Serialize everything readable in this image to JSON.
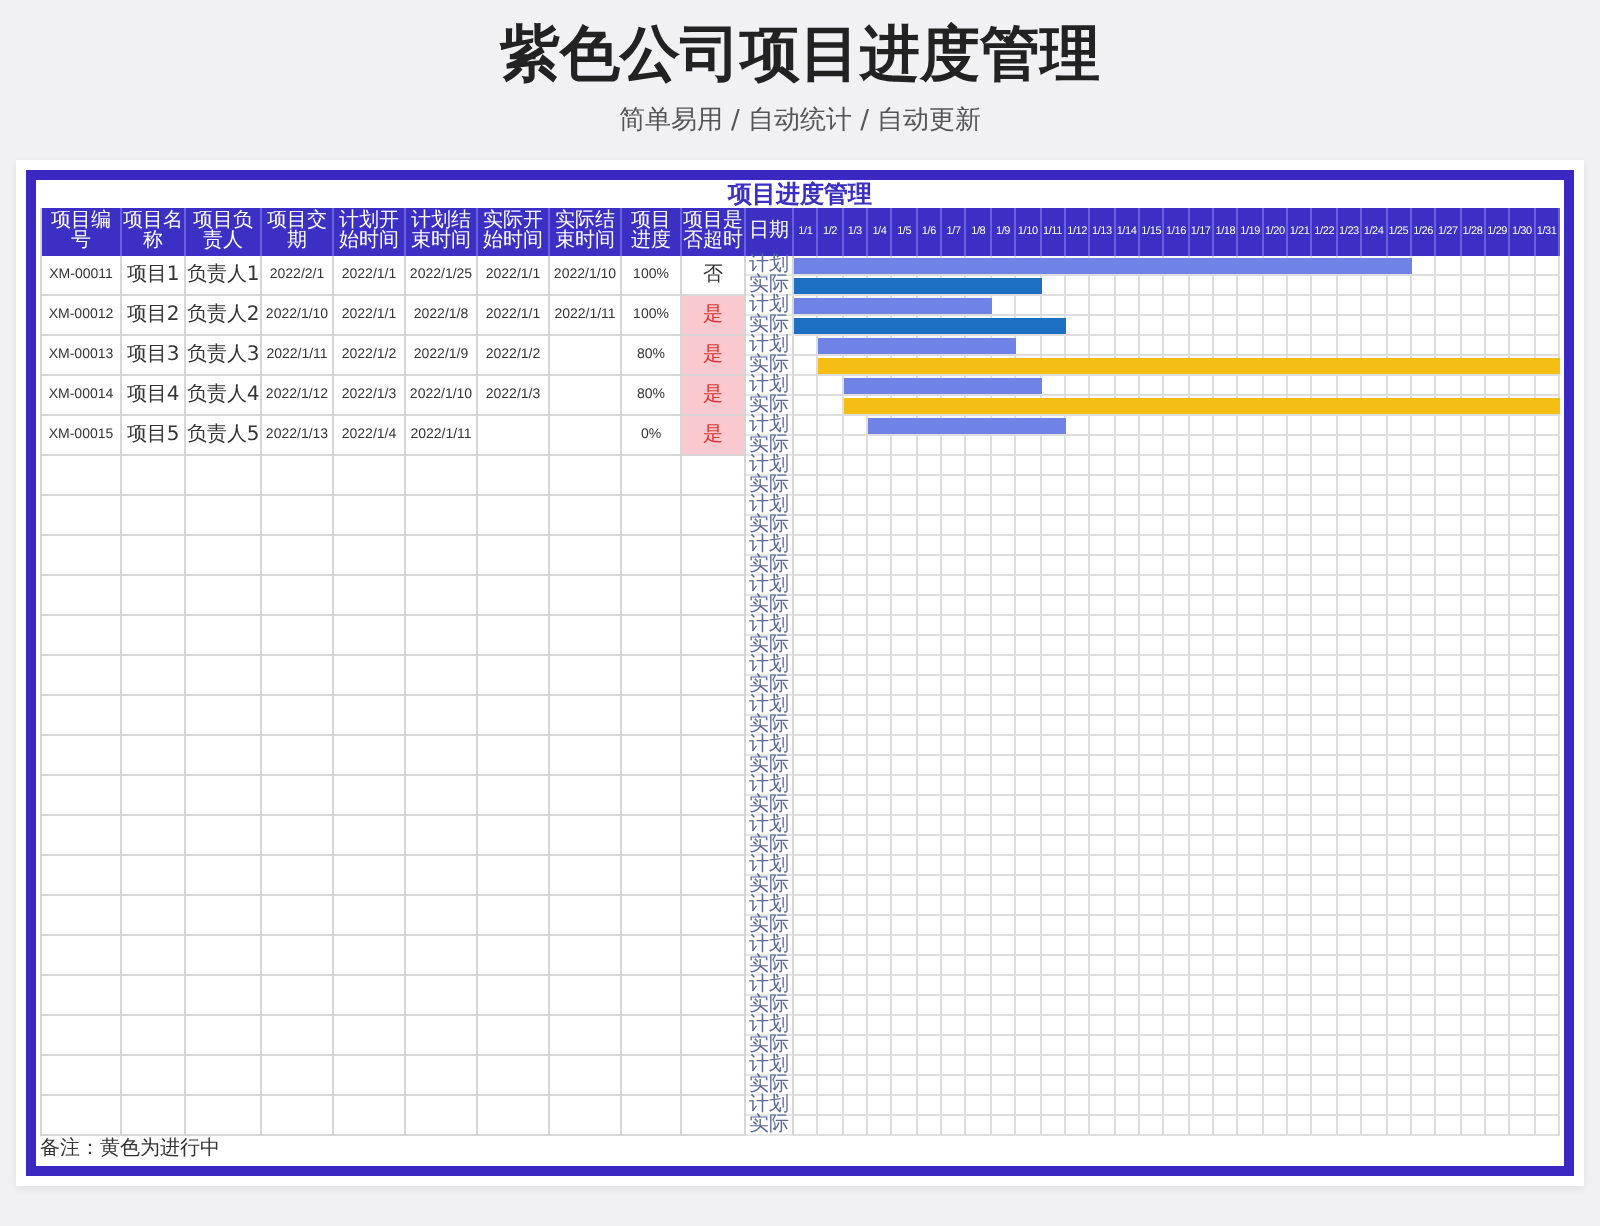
{
  "page_title": "紫色公司项目进度管理",
  "subtitle": "简单易用 / 自动统计 / 自动更新",
  "sheet": {
    "title": "项目进度管理",
    "columns": [
      "项目编号",
      "项目名称",
      "项目负责人",
      "项目交期",
      "计划开始时间",
      "计划结束时间",
      "实际开始时间",
      "实际结束时间",
      "项目进度",
      "项目是否超时",
      "日期"
    ],
    "days": [
      "1/1",
      "1/2",
      "1/3",
      "1/4",
      "1/5",
      "1/6",
      "1/7",
      "1/8",
      "1/9",
      "1/10",
      "1/11",
      "1/12",
      "1/13",
      "1/14",
      "1/15",
      "1/16",
      "1/17",
      "1/18",
      "1/19",
      "1/20",
      "1/21",
      "1/22",
      "1/23",
      "1/24",
      "1/25",
      "1/26",
      "1/27",
      "1/28",
      "1/29",
      "1/30",
      "1/31"
    ],
    "rows": [
      {
        "id": "XM-00011",
        "name": "项目1",
        "owner": "负责人1",
        "due": "2022/2/1",
        "plan_start": "2022/1/1",
        "plan_end": "2022/1/25",
        "actual_start": "2022/1/1",
        "actual_end": "2022/1/10",
        "progress": "100%",
        "overdue_text": "否",
        "overdue": false,
        "plan_label": "计划",
        "actual_label": "实际"
      },
      {
        "id": "XM-00012",
        "name": "项目2",
        "owner": "负责人2",
        "due": "2022/1/10",
        "plan_start": "2022/1/1",
        "plan_end": "2022/1/8",
        "actual_start": "2022/1/1",
        "actual_end": "2022/1/11",
        "progress": "100%",
        "overdue_text": "是",
        "overdue": true,
        "plan_label": "计划",
        "actual_label": "实际"
      },
      {
        "id": "XM-00013",
        "name": "项目3",
        "owner": "负责人3",
        "due": "2022/1/11",
        "plan_start": "2022/1/2",
        "plan_end": "2022/1/9",
        "actual_start": "2022/1/2",
        "progress": "80%",
        "overdue_text": "是",
        "overdue": true,
        "plan_label": "计划",
        "actual_label": "实际"
      },
      {
        "id": "XM-00014",
        "name": "项目4",
        "owner": "负责人4",
        "due": "2022/1/12",
        "plan_start": "2022/1/3",
        "plan_end": "2022/1/10",
        "actual_start": "2022/1/3",
        "progress": "80%",
        "overdue_text": "是",
        "overdue": true,
        "plan_label": "计划",
        "actual_label": "实际"
      },
      {
        "id": "XM-00015",
        "name": "项目5",
        "owner": "负责人5",
        "due": "2022/1/13",
        "plan_start": "2022/1/4",
        "plan_end": "2022/1/11",
        "progress": "0%",
        "overdue_text": "是",
        "overdue": true,
        "plan_label": "计划",
        "actual_label": "实际"
      },
      {
        "plan_label": "计划",
        "actual_label": "实际"
      },
      {
        "plan_label": "计划",
        "actual_label": "实际"
      },
      {
        "plan_label": "计划",
        "actual_label": "实际"
      },
      {
        "plan_label": "计划",
        "actual_label": "实际"
      },
      {
        "plan_label": "计划",
        "actual_label": "实际"
      },
      {
        "plan_label": "计划",
        "actual_label": "实际"
      },
      {
        "plan_label": "计划",
        "actual_label": "实际"
      },
      {
        "plan_label": "计划",
        "actual_label": "实际"
      },
      {
        "plan_label": "计划",
        "actual_label": "实际"
      },
      {
        "plan_label": "计划",
        "actual_label": "实际"
      },
      {
        "plan_label": "计划",
        "actual_label": "实际"
      },
      {
        "plan_label": "计划",
        "actual_label": "实际"
      },
      {
        "plan_label": "计划",
        "actual_label": "实际"
      },
      {
        "plan_label": "计划",
        "actual_label": "实际"
      },
      {
        "plan_label": "计划",
        "actual_label": "实际"
      },
      {
        "plan_label": "计划",
        "actual_label": "实际"
      },
      {
        "plan_label": "计划",
        "actual_label": "实际"
      }
    ],
    "note": "备注：黄色为进行中"
  }
}
